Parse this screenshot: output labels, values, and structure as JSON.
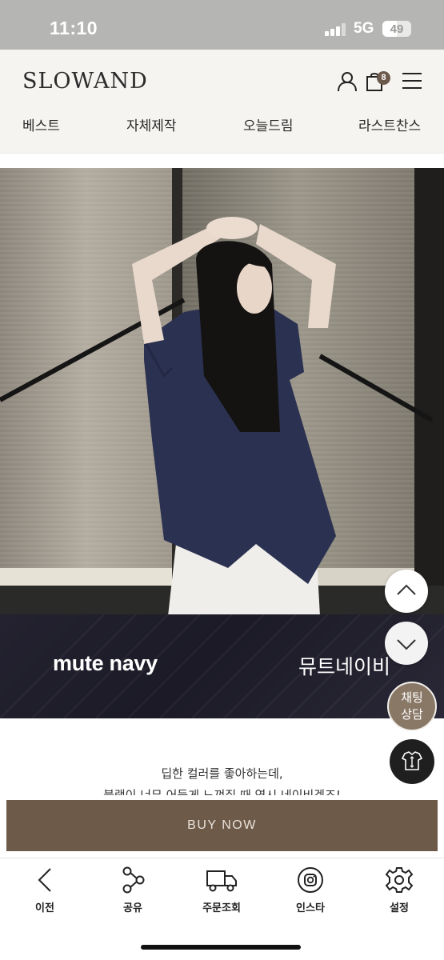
{
  "status_bar": {
    "time": "11:10",
    "network": "5G",
    "battery": "49",
    "battery_fraction": 0.49
  },
  "header": {
    "logo": "SLOWAND",
    "cart_count": "8",
    "nav": [
      "베스트",
      "자체제작",
      "오늘드림",
      "라스트찬스"
    ]
  },
  "banner": {
    "title_en": "mute navy",
    "title_ko": "뮤트네이비"
  },
  "floating": {
    "chat_line1": "채팅",
    "chat_line2": "상담"
  },
  "description": {
    "line1": "딥한 컬러를 좋아하는데,",
    "line2": "블랙이 너무 어둡게 느껴질 때 역시 네이비겠죠!"
  },
  "buy_label": "BUY NOW",
  "bottom_nav": [
    {
      "label": "이전",
      "icon": "chevron-left-icon"
    },
    {
      "label": "공유",
      "icon": "share-icon"
    },
    {
      "label": "주문조회",
      "icon": "truck-icon"
    },
    {
      "label": "인스타",
      "icon": "instagram-icon"
    },
    {
      "label": "설정",
      "icon": "gear-icon"
    }
  ],
  "colors": {
    "brand_brown": "#6e5a49",
    "header_bg": "#f6f4f1",
    "shirt_navy": "#2b3150"
  }
}
